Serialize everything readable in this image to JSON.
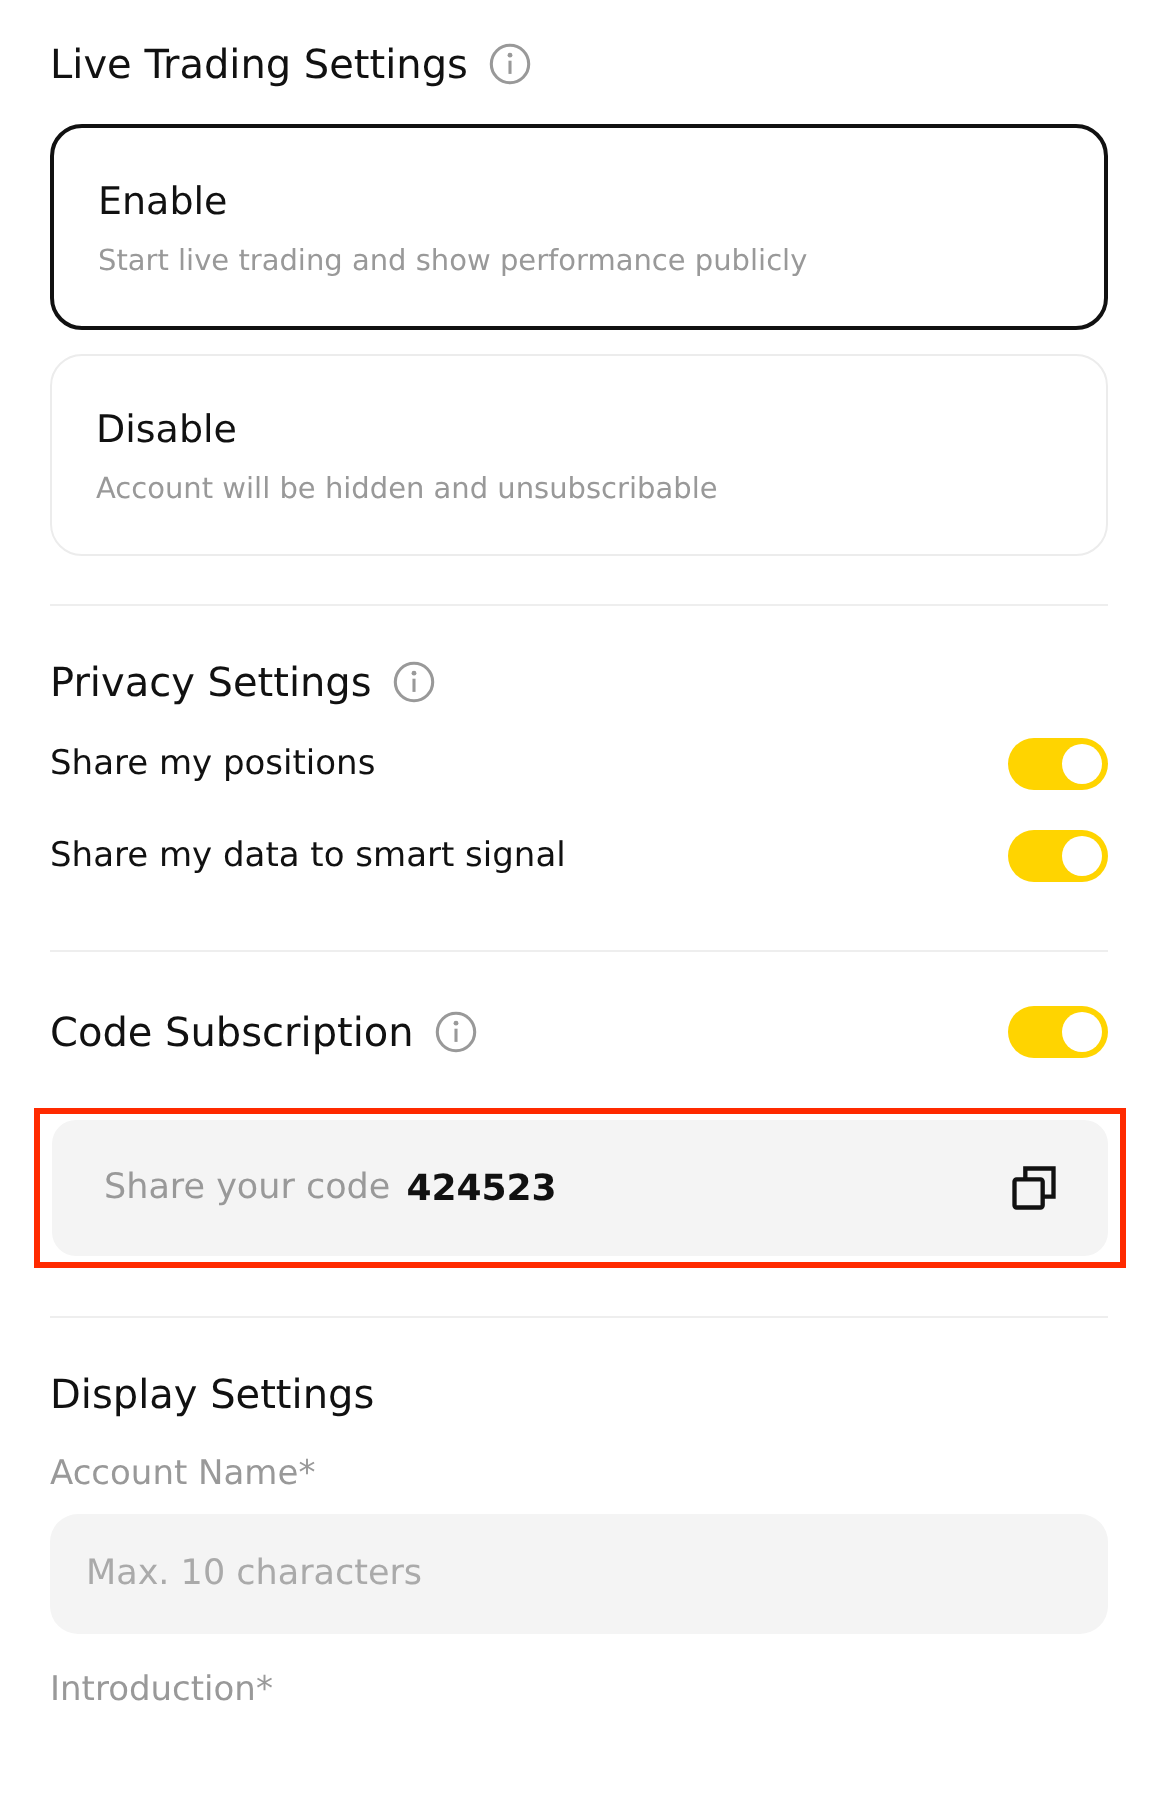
{
  "live_trading": {
    "title": "Live Trading Settings",
    "options": [
      {
        "title": "Enable",
        "description": "Start live trading and show performance publicly",
        "selected": true
      },
      {
        "title": "Disable",
        "description": "Account will be hidden and unsubscribable",
        "selected": false
      }
    ]
  },
  "privacy": {
    "title": "Privacy Settings",
    "toggles": [
      {
        "label": "Share my positions",
        "on": true
      },
      {
        "label": "Share my data to smart signal",
        "on": true
      }
    ]
  },
  "code_subscription": {
    "title": "Code Subscription",
    "on": true,
    "highlighted": true,
    "code_label": "Share your code",
    "code": "424523"
  },
  "display": {
    "title": "Display Settings",
    "fields": [
      {
        "label": "Account Name*",
        "placeholder": "Max. 10 characters"
      }
    ],
    "next_label": "Introduction*"
  }
}
